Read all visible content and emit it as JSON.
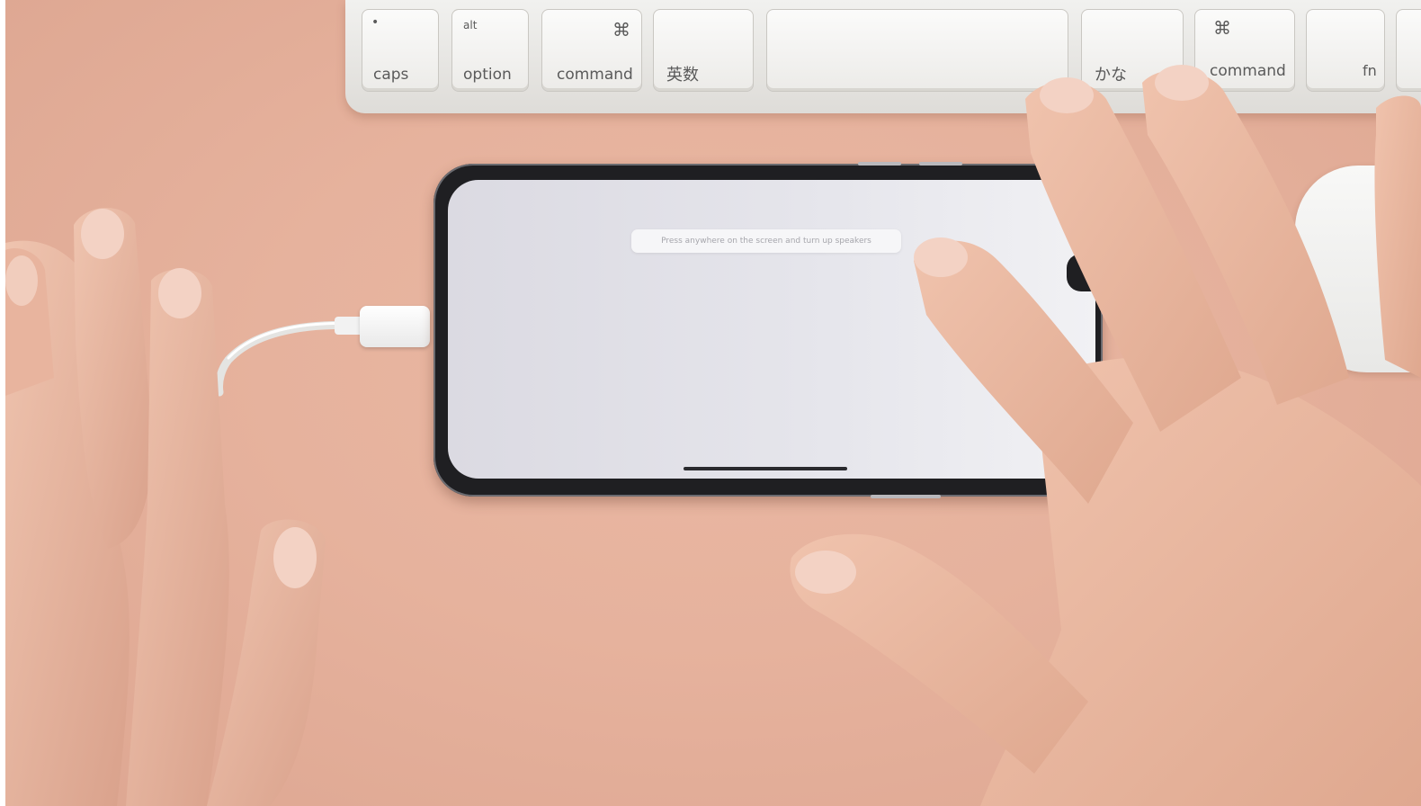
{
  "keyboard": {
    "keys": [
      {
        "label": "caps",
        "symbol": "•"
      },
      {
        "label": "option",
        "symbol": "alt"
      },
      {
        "label": "command",
        "symbol": "⌘"
      },
      {
        "label": "英数",
        "symbol": ""
      },
      {
        "label": "",
        "symbol": ""
      },
      {
        "label": "かな",
        "symbol": ""
      },
      {
        "label": "command",
        "symbol": "⌘"
      },
      {
        "label": "fn",
        "symbol": ""
      }
    ]
  },
  "phone": {
    "prompt": "Press anywhere on the screen and turn up speakers"
  },
  "colors": {
    "desk": "#e6b29d",
    "keyboard": "#eceae6",
    "phone_frame": "#1f1f22",
    "phone_screen": "#e6e6ec",
    "skin": "#e7b8a2"
  }
}
